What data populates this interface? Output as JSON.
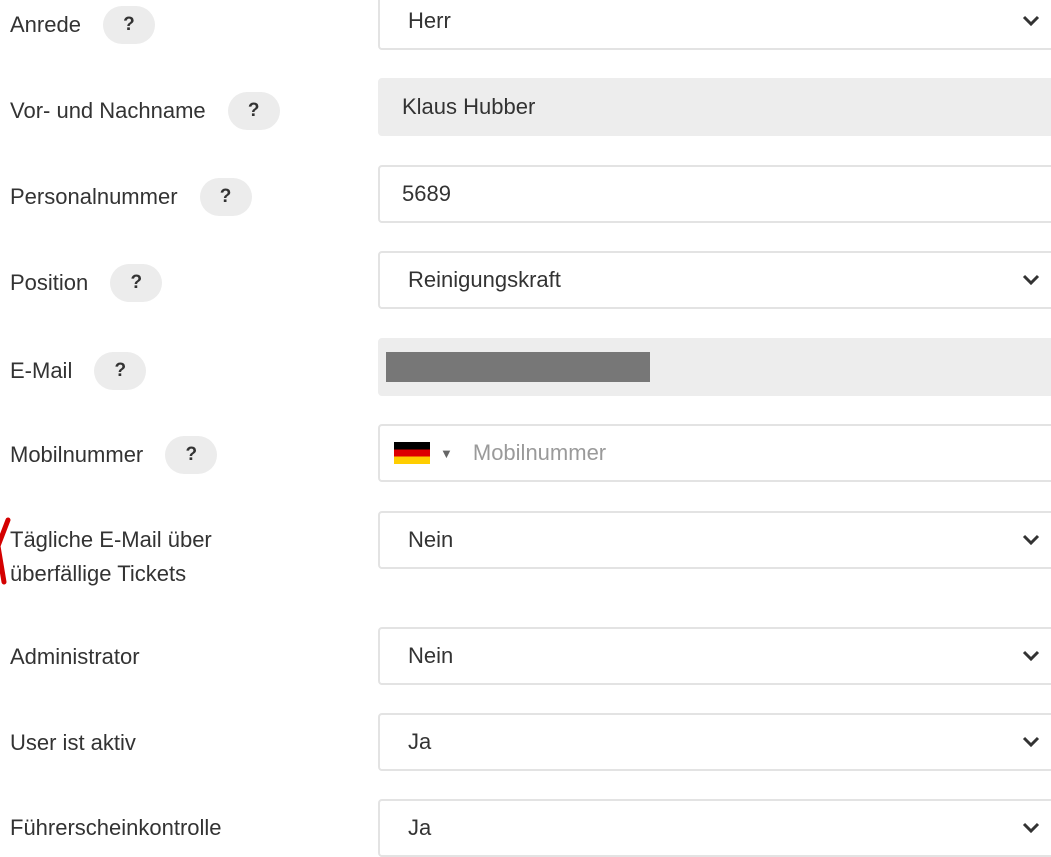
{
  "help_symbol": "?",
  "fields": {
    "anrede": {
      "label": "Anrede",
      "value": "Herr"
    },
    "name": {
      "label": "Vor- und Nachname",
      "value": "Klaus Hubber"
    },
    "personalnummer": {
      "label": "Personalnummer",
      "value": "5689"
    },
    "position": {
      "label": "Position",
      "value": "Reinigungskraft"
    },
    "email": {
      "label": "E-Mail"
    },
    "mobil": {
      "label": "Mobilnummer",
      "placeholder": "Mobilnummer"
    },
    "daily_email": {
      "label_line1": "Tägliche E-Mail über",
      "label_line2": "überfällige Tickets",
      "value": "Nein"
    },
    "administrator": {
      "label": "Administrator",
      "value": "Nein"
    },
    "aktiv": {
      "label": "User ist aktiv",
      "value": "Ja"
    },
    "fuehrerschein": {
      "label": "Führerscheinkontrolle",
      "value": "Ja"
    }
  },
  "colors": {
    "readonly_bg": "#ededed",
    "border": "#e3e3e3",
    "annotation": "#d40000"
  },
  "icons": [
    "help-icon",
    "chevron-down-icon",
    "flag-germany-icon"
  ]
}
